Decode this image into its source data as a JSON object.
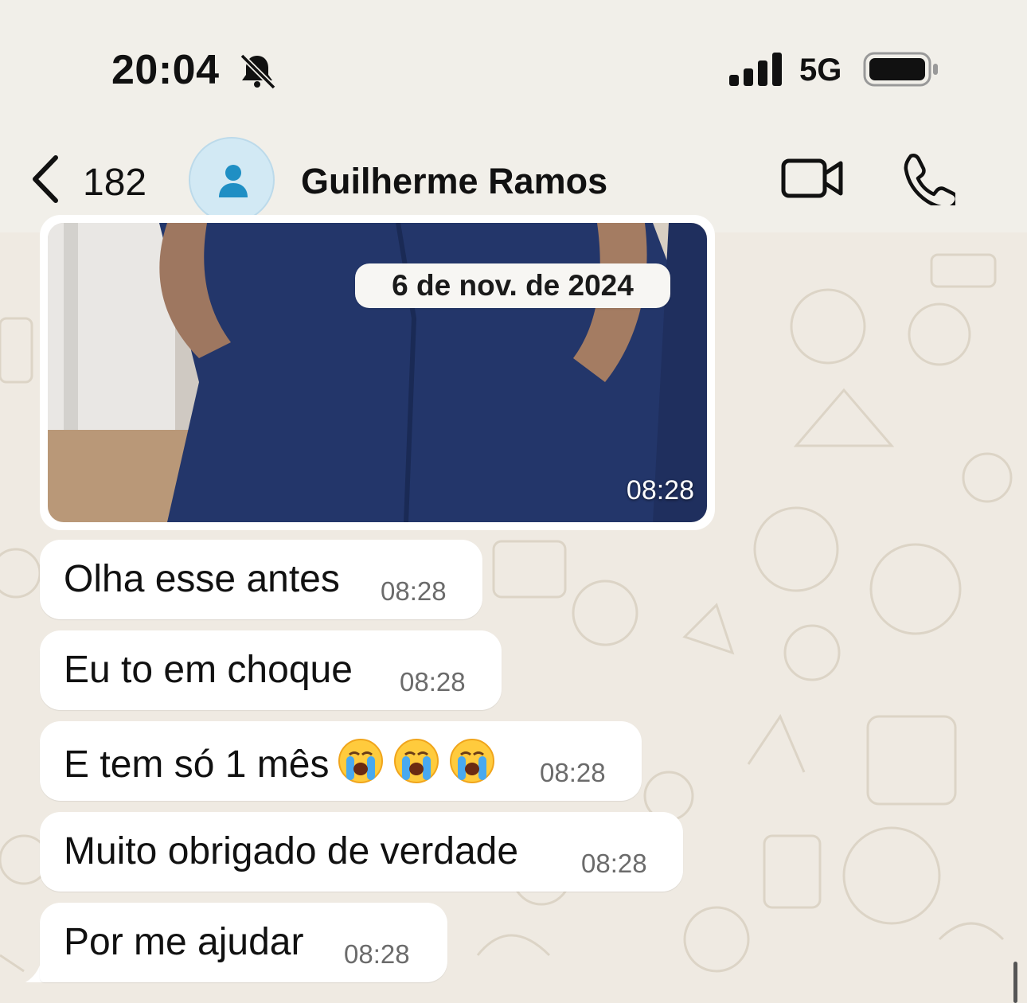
{
  "status_bar": {
    "time": "20:04",
    "network": "5G"
  },
  "header": {
    "back_count": "182",
    "contact_name": "Guilherme Ramos"
  },
  "chat": {
    "date_label": "6 de nov. de 2024",
    "photo_message": {
      "time": "08:28"
    },
    "messages": [
      {
        "text": "Olha esse antes",
        "time": "08:28"
      },
      {
        "text": "Eu to em choque",
        "time": "08:28"
      },
      {
        "text": "E tem só 1 mês",
        "emoji": "loudly-crying-face x3",
        "time": "08:28"
      },
      {
        "text": "Muito obrigado de verdade",
        "time": "08:28"
      },
      {
        "text": "Por me ajudar",
        "time": "08:28"
      }
    ]
  },
  "colors": {
    "wallpaper": "#efeae2",
    "bar": "#f1efe9",
    "bubble": "#ffffff",
    "accent": "#1f8fc4"
  }
}
